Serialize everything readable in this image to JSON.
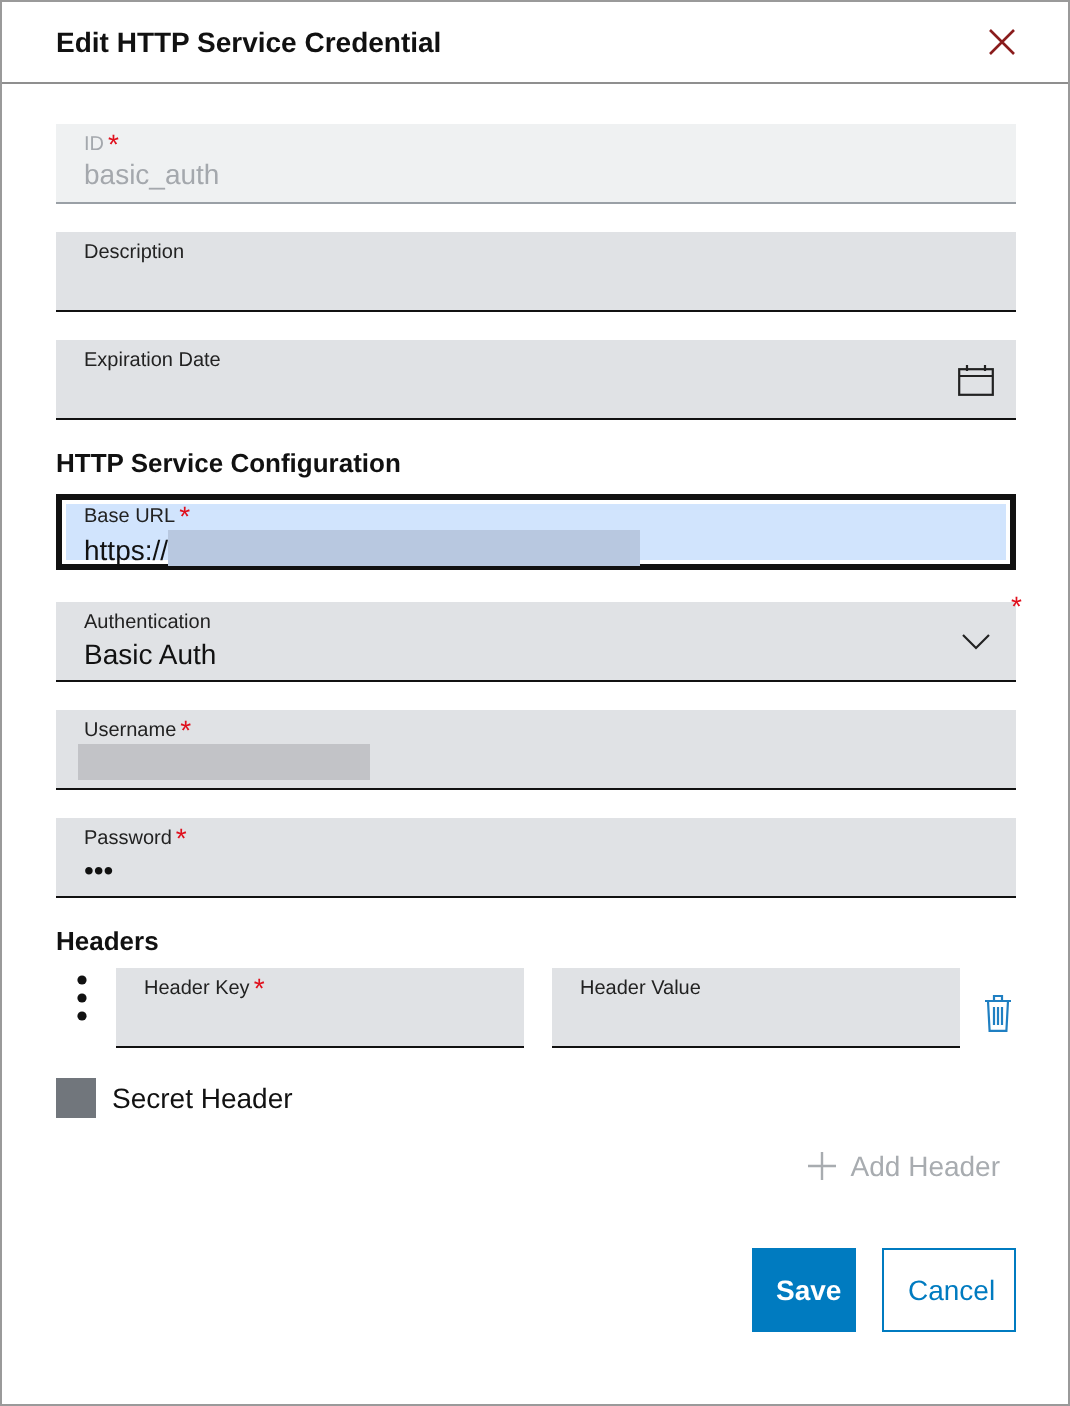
{
  "dialog": {
    "title": "Edit HTTP Service Credential"
  },
  "fields": [
    {
      "kind": "text",
      "label": "ID",
      "required_mark": "*",
      "value": "basic_auth",
      "disabled": true
    },
    {
      "kind": "text",
      "label": "Description",
      "disabled": false
    },
    {
      "kind": "date",
      "label": "Expiration Date",
      "disabled": false
    }
  ],
  "section_title": "HTTP Service Configuration",
  "config_fields": [
    {
      "kind": "text",
      "label": "Base URL",
      "required_mark": "*",
      "value": "https://",
      "redacted": true,
      "focused": true
    },
    {
      "kind": "select",
      "label": "Authentication",
      "required_mark": "*",
      "value": "Basic Auth"
    },
    {
      "kind": "text",
      "label": "Username",
      "required_mark": "*",
      "redacted": true
    },
    {
      "kind": "text",
      "label": "Password",
      "required_mark": "*",
      "value": "•••"
    }
  ],
  "headers": {
    "title": "Headers",
    "rows": [
      {
        "key_label": "Header Key",
        "key_required_mark": "*",
        "value_label": "Header Value"
      }
    ],
    "secret": {
      "label": "Secret Header",
      "checked": false
    },
    "add": {
      "label": "Add Header",
      "disabled": true
    }
  },
  "buttons": [
    {
      "label": "Save",
      "kind": "primary"
    },
    {
      "label": "Cancel",
      "kind": "secondary"
    }
  ]
}
